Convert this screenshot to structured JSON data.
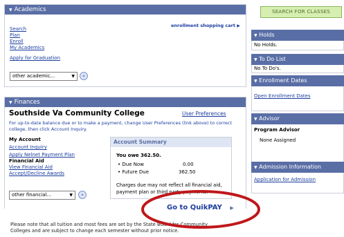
{
  "academics": {
    "title": "Academics",
    "links": [
      "Search",
      "Plan",
      "Enroll",
      "My Academics"
    ],
    "cart_link": "enrollment shopping cart",
    "apply_graduation": "Apply for Graduation",
    "select_value": "other academic..."
  },
  "finances": {
    "title": "Finances",
    "college": "Southside Va Community College",
    "user_prefs": "User Preferences",
    "info_text_1": "For up-to-date balance due or to make a payment, change User Preferences (link above) to correct",
    "info_text_2": "college, then click Account Inquiry.",
    "my_account_heading": "My Account",
    "account_links": [
      "Account Inquiry",
      "Apply Nelnet Payment Plan"
    ],
    "financial_aid_heading": "Financial Aid",
    "aid_links": [
      "View Financial Aid",
      "Accept/Decline Awards"
    ],
    "select_value": "other financial...",
    "summary": {
      "title": "Account Summary",
      "owe": "You owe 362.50.",
      "rows": [
        {
          "label": "Due Now",
          "value": "0.00"
        },
        {
          "label": "Future Due",
          "value": "362.50"
        }
      ],
      "note_1": "Charges due may not reflect all financial aid,",
      "note_2": "payment plan or third party payments."
    },
    "quikpay": "Go to QuikPAY",
    "footer_1": "Please note that all tuition and most fees are set by the State Board for Community",
    "footer_2": "Colleges and are subject to change each semester without prior notice."
  },
  "sidebar": {
    "search_button": "SEARCH FOR CLASSES",
    "holds": {
      "title": "Holds",
      "text": "No Holds."
    },
    "todo": {
      "title": "To Do List",
      "text": "No To Do's."
    },
    "enrollment": {
      "title": "Enrollment Dates",
      "link": "Open Enrollment Dates"
    },
    "advisor": {
      "title": "Advisor",
      "label": "Program Advisor",
      "value": "None Assigned"
    },
    "admission": {
      "title": "Admission Information",
      "link": "Application for Admission"
    }
  },
  "colors": {
    "header": "#5a6ea6",
    "link": "#1a3c9e",
    "annotation_circle": "#c0171b",
    "search_button_bg": "#d6efb0"
  }
}
